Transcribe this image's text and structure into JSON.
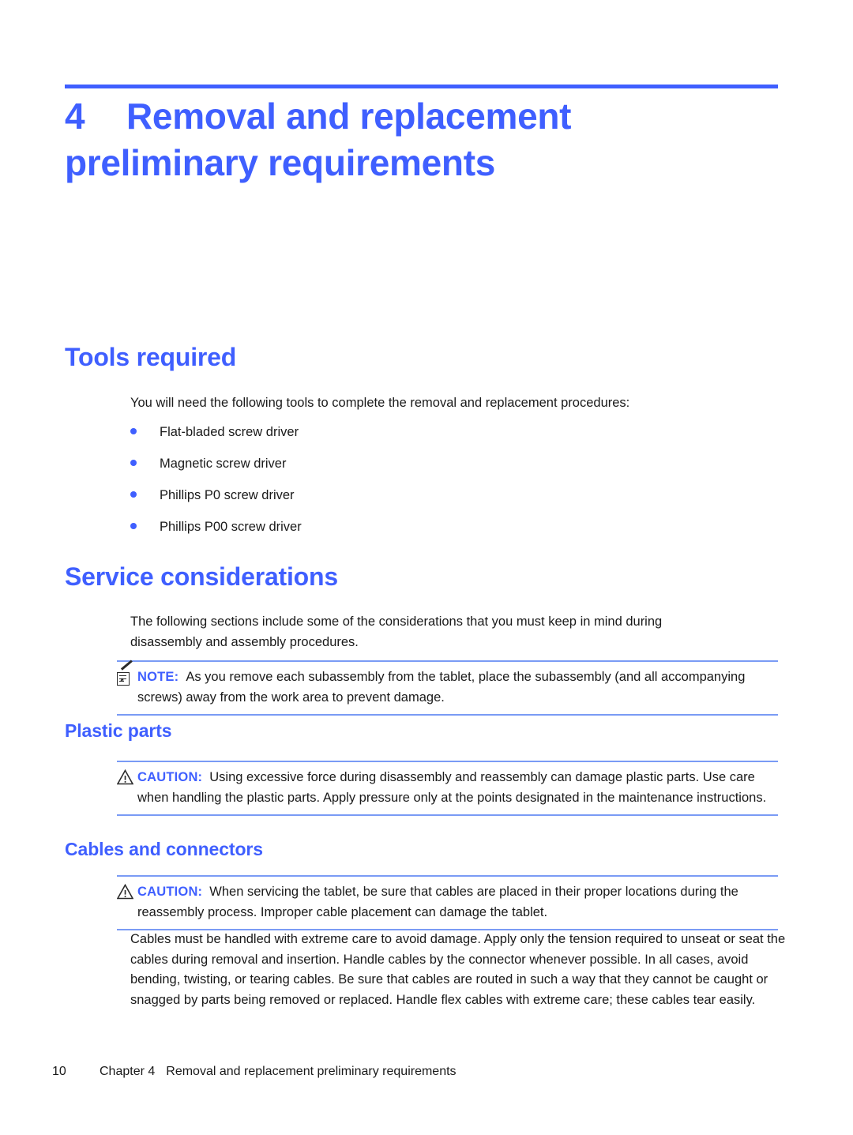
{
  "colors": {
    "heading_blue": "#3f5fff",
    "rule_blue": "#3f5fff",
    "admonition_rule_blue": "#7a9bf5",
    "body_text": "#1a1a1a"
  },
  "chapter": {
    "number": "4",
    "title": "Removal and replacement preliminary requirements"
  },
  "sections": {
    "tools_required": {
      "heading": "Tools required",
      "intro": "You will need the following tools to complete the removal and replacement procedures:",
      "bullets": [
        "Flat-bladed screw driver",
        "Magnetic screw driver",
        "Phillips P0 screw driver",
        "Phillips P00 screw driver"
      ]
    },
    "service_considerations": {
      "heading": "Service considerations",
      "intro": "The following sections include some of the considerations that you must keep in mind during disassembly and assembly procedures.",
      "note": {
        "icon": "note-pad-pencil-icon",
        "label": "NOTE:",
        "text": "As you remove each subassembly from the tablet, place the subassembly (and all accompanying screws) away from the work area to prevent damage."
      },
      "plastic_parts": {
        "heading": "Plastic parts",
        "caution": {
          "icon": "warning-triangle-icon",
          "label": "CAUTION:",
          "text": "Using excessive force during disassembly and reassembly can damage plastic parts. Use care when handling the plastic parts. Apply pressure only at the points designated in the maintenance instructions."
        }
      },
      "cables_and_connectors": {
        "heading": "Cables and connectors",
        "caution": {
          "icon": "warning-triangle-icon",
          "label": "CAUTION:",
          "text": "When servicing the tablet, be sure that cables are placed in their proper locations during the reassembly process. Improper cable placement can damage the tablet."
        },
        "body": "Cables must be handled with extreme care to avoid damage. Apply only the tension required to unseat or seat the cables during removal and insertion. Handle cables by the connector whenever possible. In all cases, avoid bending, twisting, or tearing cables. Be sure that cables are routed in such a way that they cannot be caught or snagged by parts being removed or replaced. Handle flex cables with extreme care; these cables tear easily."
      }
    }
  },
  "footer": {
    "page_number": "10",
    "chapter_label": "Chapter 4",
    "chapter_title": "Removal and replacement preliminary requirements"
  }
}
